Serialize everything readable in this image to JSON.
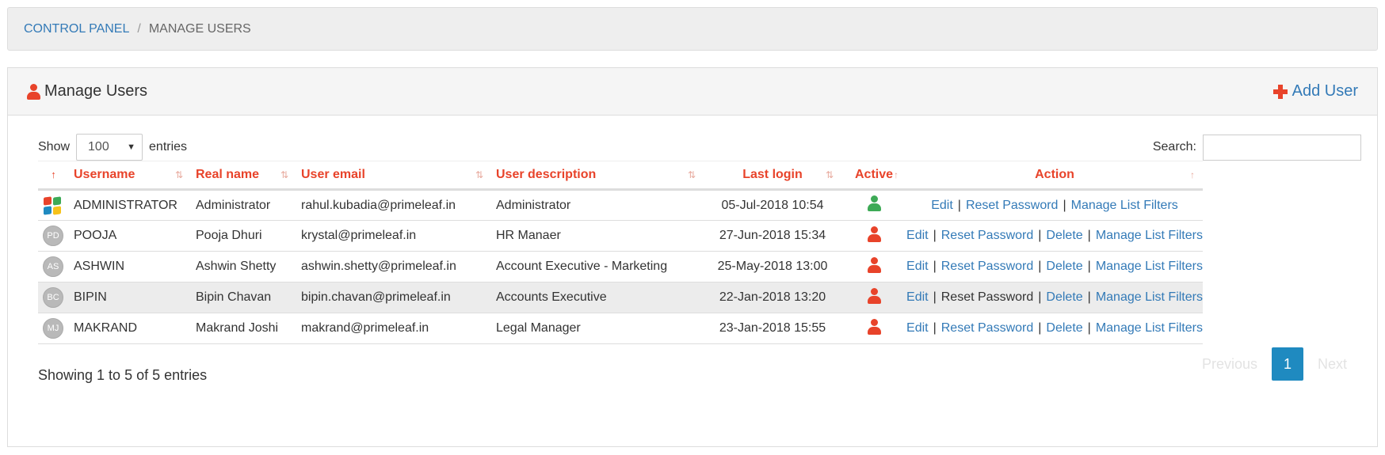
{
  "breadcrumb": {
    "root": "CONTROL PANEL",
    "separator": "/",
    "current": "MANAGE USERS"
  },
  "panel": {
    "title": "Manage Users",
    "add_user_label": "Add User"
  },
  "controls": {
    "show_label": "Show",
    "entries_value": "100",
    "entries_label": "entries",
    "search_label": "Search:",
    "search_value": ""
  },
  "table": {
    "headers": {
      "sort_icon": "↑",
      "username": "Username",
      "realname": "Real name",
      "email": "User email",
      "description": "User description",
      "last_login": "Last login",
      "active": "Active",
      "action": "Action"
    },
    "rows": [
      {
        "avatar": "windows-logo",
        "initials": "",
        "username": "ADMINISTRATOR",
        "realname": "Administrator",
        "email": "rahul.kubadia@primeleaf.in",
        "description": "Administrator",
        "last_login": "05-Jul-2018 10:54",
        "active_color": "#3daa56",
        "edit": "Edit",
        "reset": "Reset Password",
        "delete": "",
        "filters": "Manage List Filters"
      },
      {
        "avatar": "initials",
        "initials": "PD",
        "username": "POOJA",
        "realname": "Pooja Dhuri",
        "email": "krystal@primeleaf.in",
        "description": "HR Manaer",
        "last_login": "27-Jun-2018 15:34",
        "active_color": "#e8432a",
        "edit": "Edit",
        "reset": "Reset Password",
        "delete": "Delete",
        "filters": "Manage List Filters"
      },
      {
        "avatar": "initials",
        "initials": "AS",
        "username": "ASHWIN",
        "realname": "Ashwin Shetty",
        "email": "ashwin.shetty@primeleaf.in",
        "description": "Account Executive - Marketing",
        "last_login": "25-May-2018 13:00",
        "active_color": "#e8432a",
        "edit": "Edit",
        "reset": "Reset Password",
        "delete": "Delete",
        "filters": "Manage List Filters"
      },
      {
        "avatar": "initials",
        "initials": "BC",
        "username": "BIPIN",
        "realname": "Bipin Chavan",
        "email": "bipin.chavan@primeleaf.in",
        "description": "Accounts Executive",
        "last_login": "22-Jan-2018 13:20",
        "active_color": "#e8432a",
        "edit": "Edit",
        "reset": "Reset Password",
        "delete": "Delete",
        "filters": "Manage List Filters"
      },
      {
        "avatar": "initials",
        "initials": "MJ",
        "username": "MAKRAND",
        "realname": "Makrand Joshi",
        "email": "makrand@primeleaf.in",
        "description": "Legal Manager",
        "last_login": "23-Jan-2018 15:55",
        "active_color": "#e8432a",
        "edit": "Edit",
        "reset": "Reset Password",
        "delete": "Delete",
        "filters": "Manage List Filters"
      }
    ],
    "action_separator": "|"
  },
  "footer": {
    "info": "Showing 1 to 5 of 5 entries",
    "previous": "Previous",
    "page": "1",
    "next": "Next"
  },
  "colors": {
    "accent": "#e8432a",
    "link": "#337ab7",
    "pager_active": "#1f8ac0"
  }
}
